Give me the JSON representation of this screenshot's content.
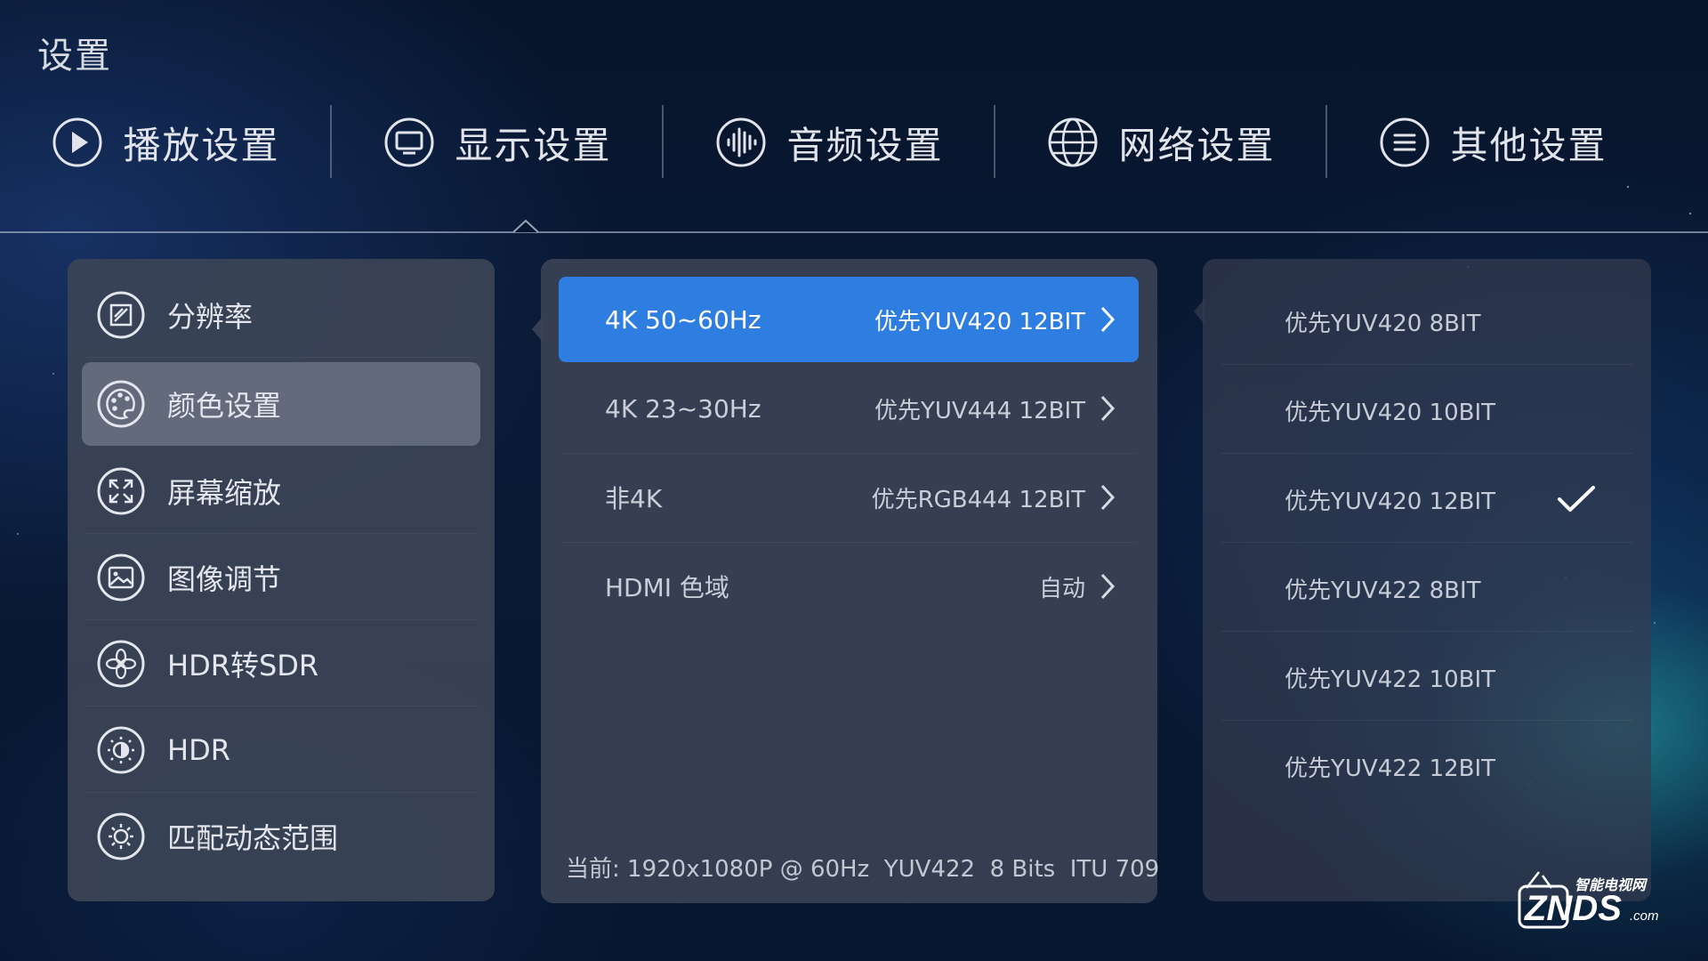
{
  "page_title": "设置",
  "tabs": [
    {
      "label": "播放设置",
      "icon": "play-icon"
    },
    {
      "label": "显示设置",
      "icon": "monitor-icon"
    },
    {
      "label": "音频设置",
      "icon": "audio-wave-icon"
    },
    {
      "label": "网络设置",
      "icon": "globe-icon"
    },
    {
      "label": "其他设置",
      "icon": "menu-lines-icon"
    }
  ],
  "active_tab": "显示设置",
  "left_menu": {
    "items": [
      {
        "label": "分辨率",
        "icon": "resolution-icon"
      },
      {
        "label": "颜色设置",
        "icon": "palette-icon"
      },
      {
        "label": "屏幕缩放",
        "icon": "expand-icon"
      },
      {
        "label": "图像调节",
        "icon": "image-icon"
      },
      {
        "label": "HDR转SDR",
        "icon": "aperture-icon"
      },
      {
        "label": "HDR",
        "icon": "hdr-icon"
      },
      {
        "label": "匹配动态范围",
        "icon": "brightness-icon"
      }
    ],
    "selected": "颜色设置"
  },
  "middle": {
    "options": [
      {
        "label": "4K 50~60Hz",
        "value": "优先YUV420 12BIT"
      },
      {
        "label": "4K 23~30Hz",
        "value": "优先YUV444 12BIT"
      },
      {
        "label": "非4K",
        "value": "优先RGB444 12BIT"
      },
      {
        "label": "HDMI 色域",
        "value": "自动"
      }
    ],
    "selected": "4K 50~60Hz",
    "status": "当前: 1920x1080P @ 60Hz  YUV422  8 Bits  ITU 709"
  },
  "right": {
    "choices": [
      {
        "label": "优先YUV420 8BIT",
        "checked": false
      },
      {
        "label": "优先YUV420 10BIT",
        "checked": false
      },
      {
        "label": "优先YUV420 12BIT",
        "checked": true
      },
      {
        "label": "优先YUV422 8BIT",
        "checked": false
      },
      {
        "label": "优先YUV422 10BIT",
        "checked": false
      },
      {
        "label": "优先YUV422 12BIT",
        "checked": false
      }
    ]
  },
  "watermark": {
    "text": "ZNDS",
    "subtext": "智能电视网",
    "suffix": ".com"
  },
  "colors": {
    "accent": "#2d7ee0",
    "panel": "#3c4456",
    "background": "#081730"
  }
}
